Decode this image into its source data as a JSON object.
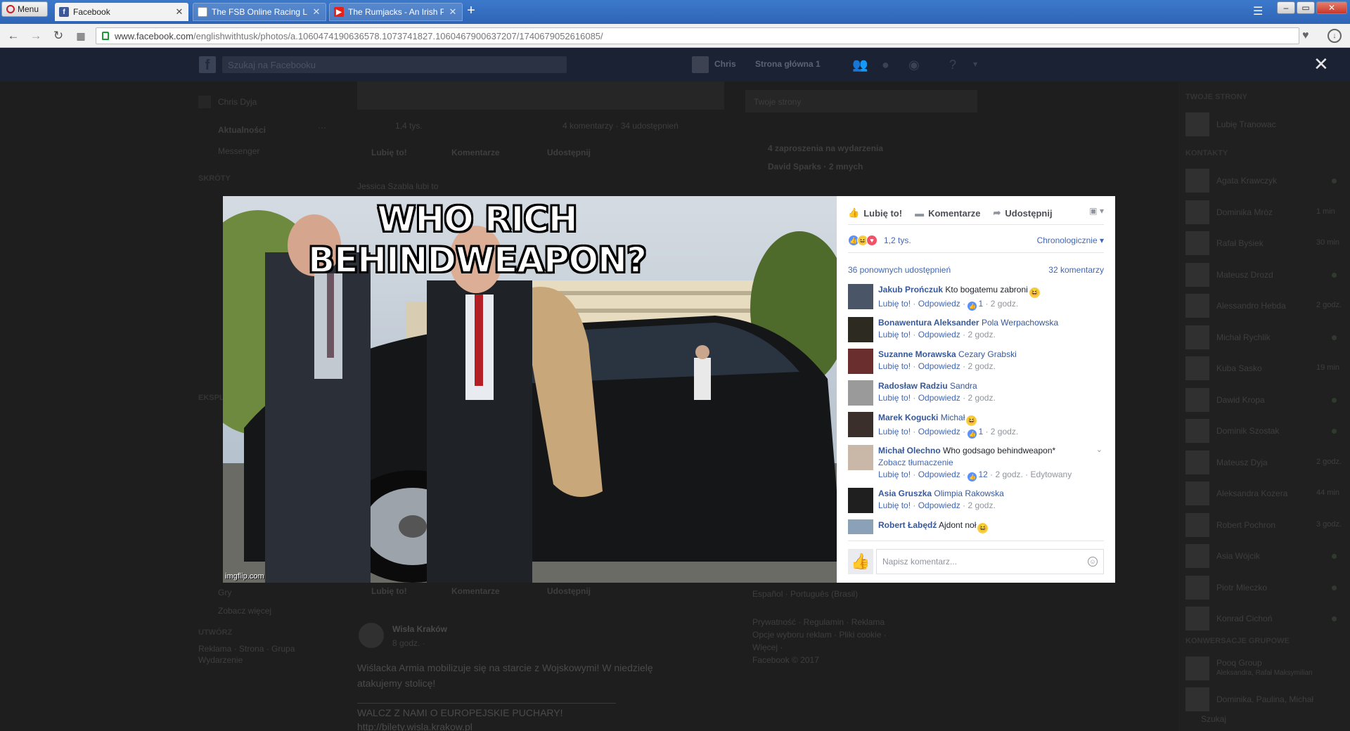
{
  "browser": {
    "menu_label": "Menu",
    "tabs": [
      {
        "title": "Facebook",
        "active": true
      },
      {
        "title": "The FSB Online Racing Lea",
        "active": false
      },
      {
        "title": "The Rumjacks - An Irish Pu",
        "active": false
      }
    ],
    "url_host": "www.facebook.com",
    "url_path": "/englishwithtusk/photos/a.1060474190636578.1073741827.1060467900637207/1740679052616085/"
  },
  "facebook_bg": {
    "logo": "f",
    "search_placeholder": "Szukaj na Facebooku",
    "user_name": "Chris",
    "home_label": "Strona główna",
    "home_count": "1",
    "left_nav": {
      "profile_name": "Chris Dyja",
      "news_feed": "Aktualności",
      "messenger": "Messenger",
      "shortcuts_header": "SKRÓTY",
      "explore_header": "EKSPLORUJ",
      "games": "Gry",
      "see_more": "Zobacz więcej",
      "create_header": "UTWÓRZ",
      "create_links": "Reklama · Strona · Grupa",
      "create_event": "Wydarzenie"
    },
    "feed": {
      "reaction_count": "1,4 tys.",
      "comments_shares": "4 komentarzy · 34 udostępnień",
      "like": "Lubię to!",
      "comment": "Komentarze",
      "share": "Udostępnij",
      "liked_by": "Jessica Szabla lubi to",
      "post2_page": "Wisła Kraków",
      "post2_time": "8 godz. ·",
      "post2_text1": "Wiślacka Armia mobilizuje się na starcie z Wojskowymi! W niedzielę",
      "post2_text2": "atakujemy stolicę!",
      "post2_text3": "WALCZ Z NAMI O EUROPEJSKIE PUCHARY!",
      "post2_link": "http://bilety.wisla.krakow.pl"
    },
    "right_col": {
      "your_pages": "Twoje strony",
      "invites": "4 zaproszenia na wydarzenia",
      "birthday": "David Sparks · 2 mnych",
      "languages": "Español · Português (Brasil)",
      "footer1": "Prywatność · Regulamin · Reklama",
      "footer2": "Opcje wyboru reklam · Pliki cookie ·",
      "footer3": "Więcej ·",
      "footer4": "Facebook © 2017"
    },
    "sidebar": {
      "your_pages_header": "TWOJE STRONY",
      "page_name": "Lubię Tranowac",
      "contacts_header": "KONTAKTY",
      "contacts": [
        {
          "name": "Agata Krawczyk",
          "status": "online"
        },
        {
          "name": "Dominika Mróz",
          "status": "1 min"
        },
        {
          "name": "Rafał Byśiek",
          "status": "30 min"
        },
        {
          "name": "Mateusz Drozd",
          "status": "online"
        },
        {
          "name": "Alessandro Hebda",
          "status": "2 godz."
        },
        {
          "name": "Michał Rychlik",
          "status": "online"
        },
        {
          "name": "Kuba Sasko",
          "status": "19 min"
        },
        {
          "name": "Dawid Kropa",
          "status": "online"
        },
        {
          "name": "Dominik Szostak",
          "status": "online"
        },
        {
          "name": "Mateusz Dyja",
          "status": "2 godz."
        },
        {
          "name": "Aleksandra Kozera",
          "status": "44 min"
        },
        {
          "name": "Robert Pochron",
          "status": "3 godz."
        },
        {
          "name": "Asia Wójcik",
          "status": "online"
        },
        {
          "name": "Piotr Mleczko",
          "status": "online"
        },
        {
          "name": "Konrad Cichoń",
          "status": "online"
        }
      ],
      "groups_header": "KONWERSACJE GRUPOWE",
      "group1": "Pooq Group",
      "group1_sub": "Aleksandra, Rafał Maksymilian",
      "group2": "Dominika, Paulina, Michał",
      "search_placeholder": "Szukaj"
    }
  },
  "viewer": {
    "close_label": "✕",
    "meme_caption": "WHO RICH BEHINDWEAPON?",
    "watermark": "imgflip.com",
    "actions": {
      "like": "Lubię to!",
      "comment": "Komentarze",
      "share": "Udostępnij"
    },
    "reactions": {
      "count": "1,2 tys.",
      "order": "Chronologicznie"
    },
    "shares": "36 ponownych udostępnień",
    "comments_count": "32 komentarzy",
    "reply_label": "Odpowiedz",
    "like_label": "Lubię to!",
    "translate_label": "Zobacz tłumaczenie",
    "edited_label": "Edytowany",
    "comments": [
      {
        "name": "Jakub Prończuk",
        "text": "Kto bogatemu zabroni",
        "emoji": true,
        "likes": "1",
        "time": "2 godz.",
        "avatar": "#4a5568"
      },
      {
        "name": "Bonawentura Aleksander",
        "text": "Pola Werpachowska",
        "tag": true,
        "likes": "",
        "time": "2 godz.",
        "avatar": "#2d2a22"
      },
      {
        "name": "Suzanne Morawska",
        "text": "Cezary Grabski",
        "tag": true,
        "likes": "",
        "time": "2 godz.",
        "avatar": "#6b2e2e"
      },
      {
        "name": "Radosław Radziu",
        "text": "Sandra",
        "tag": true,
        "likes": "",
        "time": "2 godz.",
        "avatar": "#9a9a9a"
      },
      {
        "name": "Marek Kogucki",
        "text": "Michał",
        "tag": true,
        "emoji": true,
        "likes": "1",
        "time": "2 godz.",
        "avatar": "#3a2f2a"
      },
      {
        "name": "Michał Olechno",
        "text": "Who godsago behindweapon*",
        "translate": true,
        "likes": "12",
        "time": "2 godz.",
        "edited": true,
        "avatar": "#c9b8a8"
      },
      {
        "name": "Asia Gruszka",
        "text": "Olimpia Rakowska",
        "tag": true,
        "likes": "",
        "time": "2 godz.",
        "avatar": "#1f1f1f"
      },
      {
        "name": "Robert Łabędź",
        "text": "Ajdont noł",
        "emoji": true,
        "likes": "",
        "time": "2 godz.",
        "avatar": "#8aa1b8"
      }
    ],
    "compose_placeholder": "Napisz komentarz..."
  }
}
